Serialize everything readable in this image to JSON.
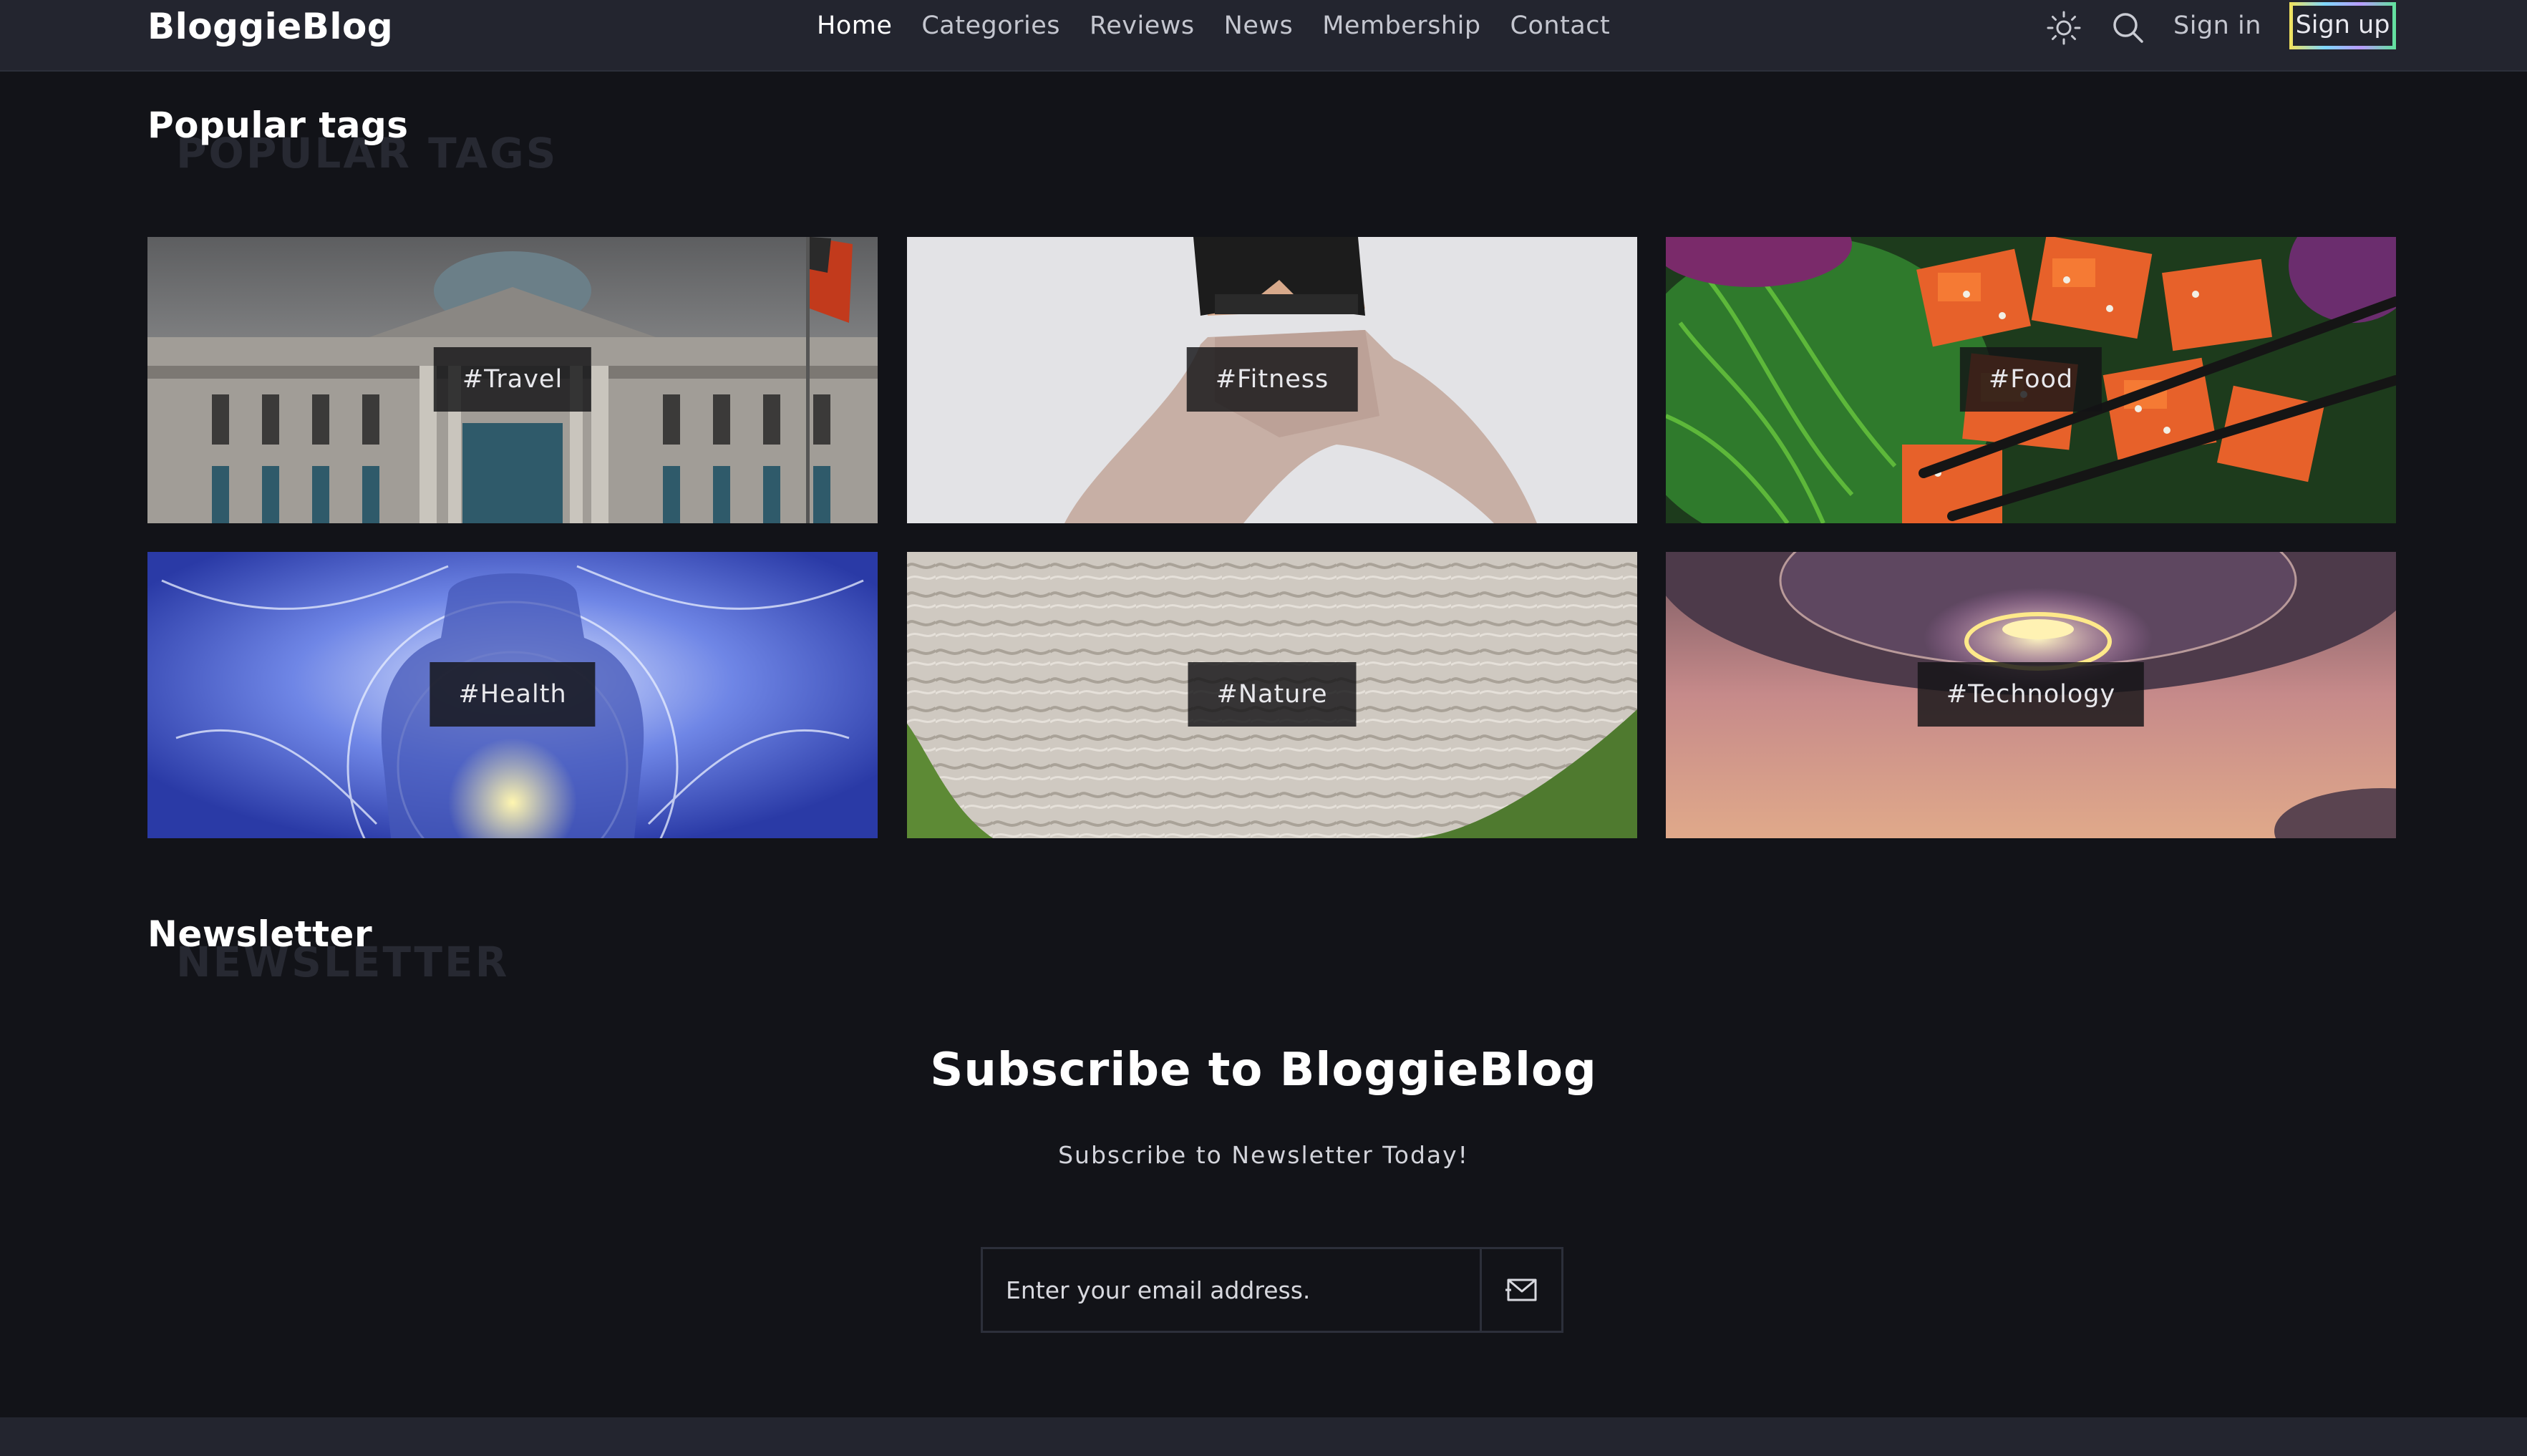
{
  "brand": {
    "name": "BloggieBlog"
  },
  "nav": {
    "items": [
      {
        "label": "Home",
        "active": true
      },
      {
        "label": "Categories",
        "active": false
      },
      {
        "label": "Reviews",
        "active": false
      },
      {
        "label": "News",
        "active": false
      },
      {
        "label": "Membership",
        "active": false
      },
      {
        "label": "Contact",
        "active": false
      }
    ]
  },
  "header_actions": {
    "theme_icon": "sun-icon",
    "search_icon": "search-icon",
    "signin_label": "Sign in",
    "signup_label": "Sign up"
  },
  "popular_tags": {
    "title": "Popular tags",
    "ghost_title": "POPULAR TAGS",
    "tags": [
      {
        "label": "#Travel"
      },
      {
        "label": "#Fitness"
      },
      {
        "label": "#Food"
      },
      {
        "label": "#Health"
      },
      {
        "label": "#Nature"
      },
      {
        "label": "#Technology"
      }
    ]
  },
  "newsletter": {
    "title": "Newsletter",
    "ghost_title": "NEWSLETTER",
    "heading": "Subscribe to BloggieBlog",
    "subtext": "Subscribe to Newsletter Today!",
    "email_placeholder": "Enter your email address.",
    "send_icon": "mail-send-icon"
  },
  "colors": {
    "page_bg": "#121318",
    "header_bg": "#23252f",
    "accent_gradient": [
      "#f4e25a",
      "#7fd8ff",
      "#b99cff",
      "#5fe39b"
    ]
  }
}
